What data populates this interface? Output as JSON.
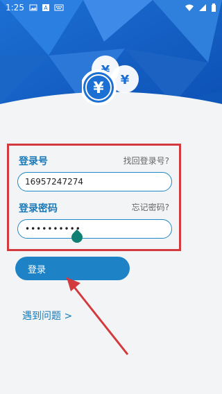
{
  "status_bar": {
    "time": "1:25"
  },
  "form": {
    "account_label": "登录号",
    "find_account_link": "找回登录号?",
    "account_value": "16957247274",
    "password_label": "登录密码",
    "forgot_password_link": "忘记密码?",
    "password_value": "••••••••••"
  },
  "actions": {
    "login_label": "登录",
    "problem_link": "遇到问题 >"
  },
  "colors": {
    "brand": "#1779b8",
    "highlight": "#d23a3e",
    "handle": "#0f7f73"
  },
  "icons": {
    "status_left": [
      "image-icon",
      "text-icon",
      "keyboard-icon"
    ],
    "status_right": [
      "wifi-icon",
      "signal-icon",
      "battery-icon"
    ],
    "logo": "yuan-coins-icon"
  }
}
